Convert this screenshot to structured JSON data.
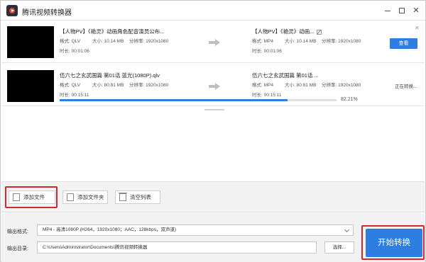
{
  "app": {
    "title": "腾讯视频转换器"
  },
  "tasks": [
    {
      "source": {
        "name": "【人物PV】《艳灵》动画角色配音演员公布...",
        "format_label": "格式: QLV",
        "size_label": "大小: 10.14 MB",
        "resolution_label": "分辨率: 1920x1080",
        "duration_label": "时长: 00:01:06"
      },
      "output": {
        "name": "【人物PV】《艳灵》动画...",
        "format_label": "格式: MP4",
        "size_label": "大小: 10.14 MB",
        "resolution_label": "分辨率: 1920x1080",
        "duration_label": "时长: 00:01:06"
      },
      "action_label": "查看"
    },
    {
      "source": {
        "name": "伍六七之玄武国篇 第01话 蓝光(1080P).qlv",
        "format_label": "格式: QLV",
        "size_label": "大小: 80.81 MB",
        "resolution_label": "分辨率: 1920x1080",
        "duration_label": "时长: 00:15:11"
      },
      "output": {
        "name": "伍六七之玄武国篇 第01话 ...",
        "format_label": "格式: MP4",
        "size_label": "大小: 80.81 MB",
        "resolution_label": "分辨率: 1920x1080",
        "duration_label": "时长: 00:15:11"
      },
      "status_label": "正在转换...",
      "progress": 0.8221,
      "progress_text": "82.21%"
    }
  ],
  "toolbar": {
    "add_file": "添加文件",
    "add_folder": "添加文件夹",
    "clear_list": "清空列表"
  },
  "settings": {
    "format_label": "输出格式:",
    "format_value": "MP4 - 高清1080P (H264，1920x1080；AAC，128kbps，双声道)",
    "dir_label": "输出目录:",
    "dir_value": "C:\\Users\\Administrator\\Documents\\腾讯视频转换器",
    "browse_label": "选择..."
  },
  "start_button": "开始转换",
  "colors": {
    "accent": "#2e7de1",
    "highlight": "#d9262c"
  }
}
